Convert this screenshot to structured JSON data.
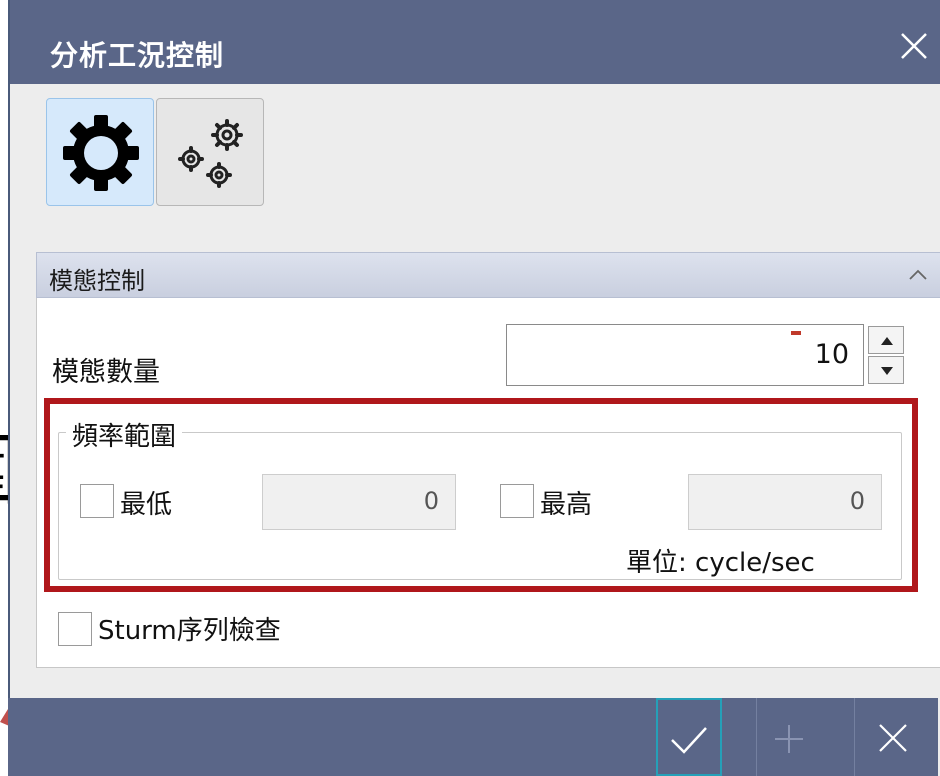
{
  "window": {
    "title": "分析工況控制"
  },
  "background": {
    "cut_glyph": "圍"
  },
  "toolbar": {
    "buttons": [
      {
        "icon": "single-gear-icon",
        "active": true
      },
      {
        "icon": "multi-gear-icon",
        "active": false
      }
    ]
  },
  "section": {
    "title": "模態控制",
    "collapse_icon": "chevron-up-icon"
  },
  "mode_count": {
    "label": "模態數量",
    "value": "10"
  },
  "frequency_range": {
    "legend": "頻率範圍",
    "min": {
      "label": "最低",
      "value": "0",
      "checked": false
    },
    "max": {
      "label": "最高",
      "value": "0",
      "checked": false
    },
    "unit": "單位: cycle/sec"
  },
  "sturm": {
    "label": "Sturm序列檢查",
    "checked": false
  },
  "footer": {
    "ok_icon": "check-icon",
    "add_icon": "plus-icon",
    "cancel_icon": "close-icon"
  },
  "colors": {
    "titlebar": "#5a6688",
    "highlight_frame": "#b0171b",
    "annotation_arrow": "#c0504d",
    "ok_border": "#25a0b8"
  }
}
